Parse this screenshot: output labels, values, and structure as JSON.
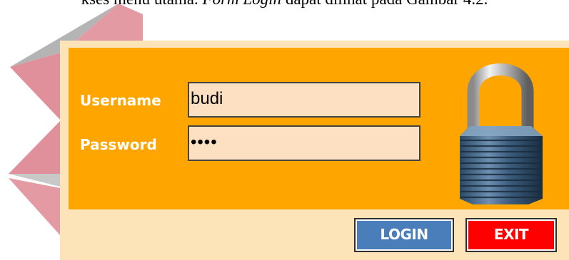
{
  "caption": {
    "prefix": "kses menu utama. ",
    "italic": "Form Login",
    "suffix": " dapat dilihat pada Gambar 4.2."
  },
  "login_form": {
    "username_label": "Username",
    "password_label": "Password",
    "username_value": "budi",
    "password_value": "••••",
    "login_button": "LOGIN",
    "exit_button": "EXIT",
    "icon": "padlock-icon"
  },
  "colors": {
    "panel": "#ffa500",
    "window": "#fde4b8",
    "field": "#fddfc1",
    "login_button": "#4a7ebb",
    "exit_button": "#fe0000",
    "watermark_red": "#e0909a",
    "watermark_gray": "#b4b4b4"
  }
}
